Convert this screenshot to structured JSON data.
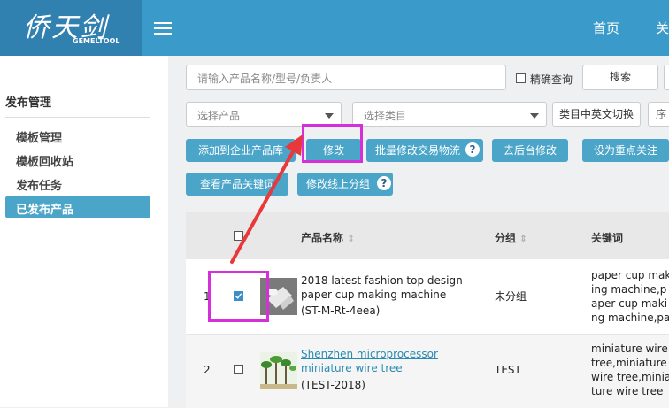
{
  "header": {
    "logo_cn": "侨天剑",
    "logo_en": "GEMELTOOL",
    "nav": [
      "首页",
      "关"
    ]
  },
  "sidebar": {
    "title": "发布管理",
    "items": [
      {
        "label": "模板管理"
      },
      {
        "label": "模板回收站"
      },
      {
        "label": "发布任务"
      },
      {
        "label": "已发布产品"
      }
    ]
  },
  "filters": {
    "search_placeholder": "请输入产品名称/型号/负责人",
    "exact_label": "精确查询",
    "search_button": "搜索",
    "product_select": "选择产品",
    "category_select": "选择类目",
    "category_toggle": "类目中英文切换",
    "truncated": "序"
  },
  "actions": {
    "add_to_lib": "添加到企业产品库",
    "modify": "修改",
    "batch_modify": "批量修改交易物流",
    "go_backend": "去后台修改",
    "set_focus": "设为重点关注",
    "view_keywords": "查看产品关键词",
    "modify_group": "修改线上分组",
    "help": "?"
  },
  "table": {
    "columns": [
      "产品名称",
      "分组",
      "关键词"
    ],
    "sort_glyph": "⇕",
    "rows": [
      {
        "index": "1",
        "checked": true,
        "name": "2018 latest fashion top design paper cup making machine",
        "model": "(ST-M-Rt-4eea)",
        "group": "未分组",
        "keywords": "paper cup making machine,paper cup making machine,paper cup making ma"
      },
      {
        "index": "2",
        "checked": false,
        "name": "Shenzhen microprocessor miniature wire tree",
        "model": "(TEST-2018)",
        "group": "TEST",
        "keywords": "miniature wire tree,miniature wire tree,miniature wire tree"
      }
    ]
  },
  "colors": {
    "topbar": "#3a9ac9",
    "accent": "#4ba5c9",
    "highlight": "#d52fd9",
    "arrow": "#e8383a"
  }
}
